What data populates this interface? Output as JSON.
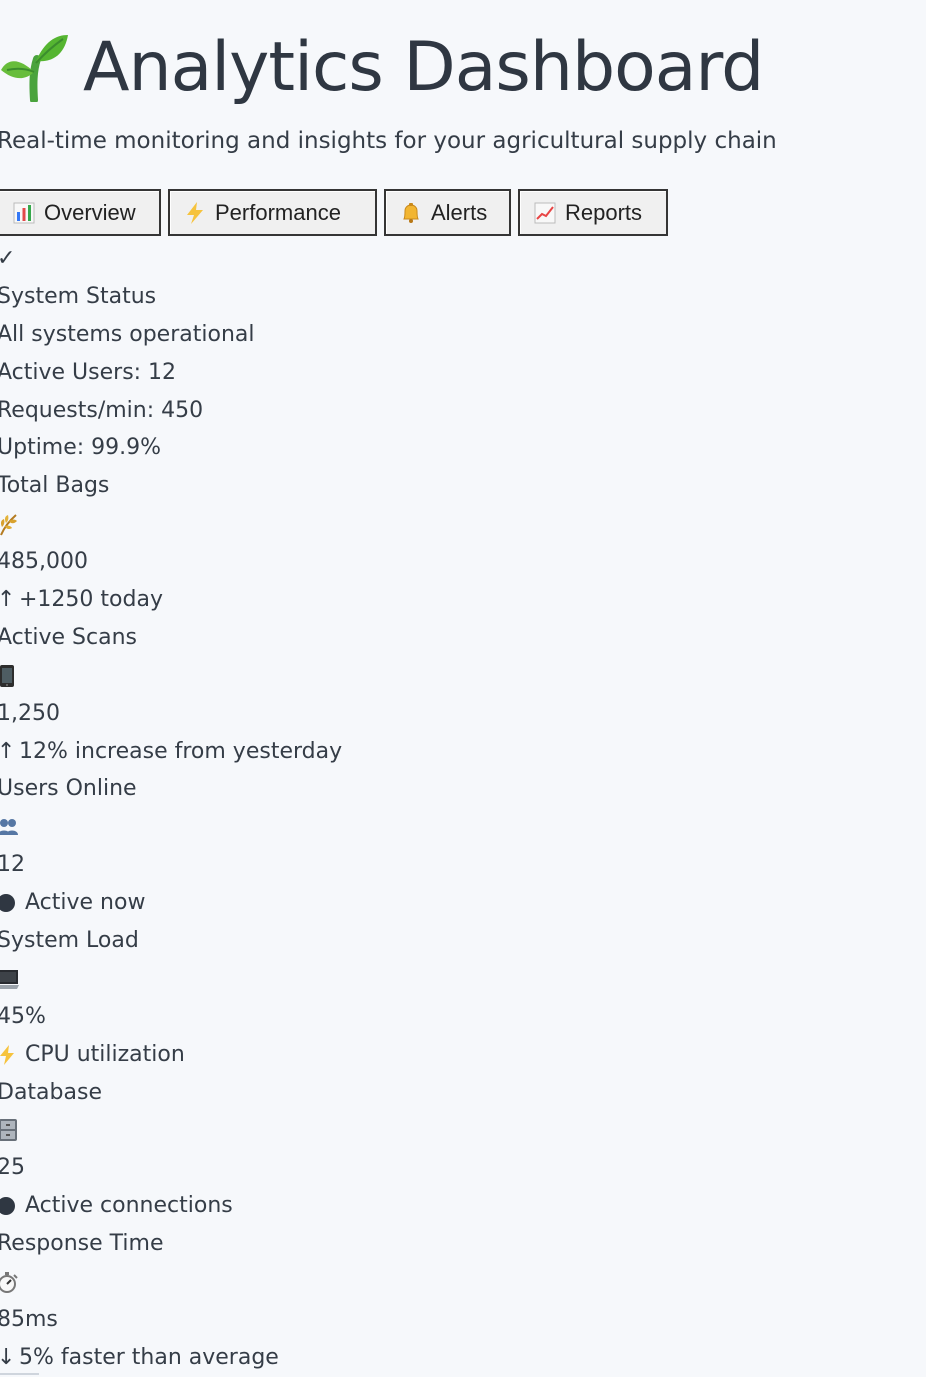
{
  "header": {
    "title": "Analytics Dashboard",
    "subtitle": "Real-time monitoring and insights for your agricultural supply chain",
    "logo_icon": "seedling-icon"
  },
  "tabs": [
    {
      "label": "Overview",
      "icon": "bar-chart-icon"
    },
    {
      "label": "Performance",
      "icon": "lightning-icon"
    },
    {
      "label": "Alerts",
      "icon": "bell-icon"
    },
    {
      "label": "Reports",
      "icon": "line-chart-icon"
    }
  ],
  "system_status": {
    "check_icon": "✓",
    "title": "System Status",
    "status": "All systems operational",
    "active_users": "Active Users: 12",
    "requests": "Requests/min: 450",
    "uptime": "Uptime: 99.9%"
  },
  "metrics": {
    "total_bags": {
      "label": "Total Bags",
      "icon": "wheat-icon",
      "value": "485,000",
      "note_arrow": "↑",
      "note": "+1250 today"
    },
    "active_scans": {
      "label": "Active Scans",
      "icon": "phone-icon",
      "value": "1,250",
      "note_arrow": "↑",
      "note": "12% increase from yesterday"
    },
    "users_online": {
      "label": "Users Online",
      "icon": "users-icon",
      "value": "12",
      "note_icon": "status-dot-icon",
      "note": "Active now"
    },
    "system_load": {
      "label": "System Load",
      "icon": "laptop-icon",
      "value": "45%",
      "note_icon": "lightning-icon",
      "note": "CPU utilization"
    },
    "database": {
      "label": "Database",
      "icon": "file-cabinet-icon",
      "value": "25",
      "note_icon": "status-dot-icon",
      "note": "Active connections"
    },
    "response_time": {
      "label": "Response Time",
      "icon": "stopwatch-icon",
      "value": "85ms",
      "note_arrow": "↓",
      "note": "5% faster than average"
    }
  },
  "colors": {
    "background": "#f6f8fb",
    "text": "#2f3742",
    "accent_yellow": "#f5b82e",
    "accent_green": "#4aa33d"
  }
}
